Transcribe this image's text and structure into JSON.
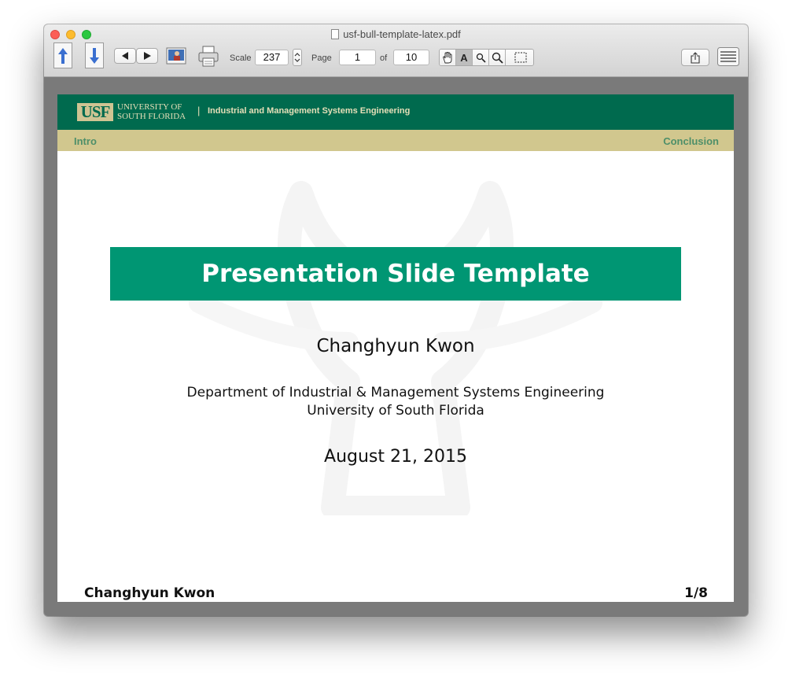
{
  "window": {
    "title": "usf-bull-template-latex.pdf"
  },
  "toolbar": {
    "scale_label": "Scale",
    "scale_value": "237",
    "page_label": "Page",
    "page_value": "1",
    "of_label": "of",
    "page_total": "10"
  },
  "slide": {
    "logo_text": "USF",
    "university_line1": "UNIVERSITY OF",
    "university_line2": "SOUTH FLORIDA",
    "header_separator": "|",
    "department_header": "Industrial and Management Systems Engineering",
    "nav_left": "Intro",
    "nav_right": "Conclusion",
    "title": "Presentation Slide Template",
    "author": "Changhyun Kwon",
    "department": "Department of Industrial & Management Systems Engineering",
    "university": "University of South Florida",
    "date": "August 21, 2015",
    "footer_author": "Changhyun Kwon",
    "footer_page": "1/8"
  },
  "colors": {
    "usf_green": "#006a4e",
    "usf_gold": "#cfc493",
    "title_bar": "#009673"
  }
}
